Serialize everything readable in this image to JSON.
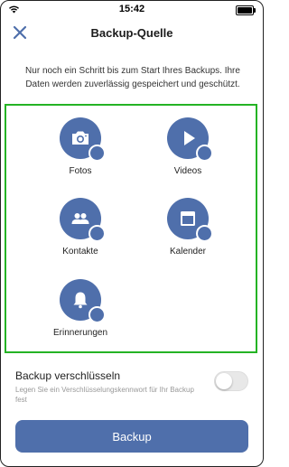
{
  "status": {
    "time": "15:42"
  },
  "header": {
    "title": "Backup-Quelle"
  },
  "description": "Nur noch ein Schritt bis zum Start Ihres Backups. Ihre Daten werden zuverlässig gespeichert und geschützt.",
  "sources": [
    {
      "label": "Fotos",
      "icon": "camera-icon",
      "selected": true
    },
    {
      "label": "Videos",
      "icon": "play-icon",
      "selected": true
    },
    {
      "label": "Kontakte",
      "icon": "contacts-icon",
      "selected": true
    },
    {
      "label": "Kalender",
      "icon": "calendar-icon",
      "selected": true
    },
    {
      "label": "Erinnerungen",
      "icon": "bell-icon",
      "selected": true
    }
  ],
  "encrypt": {
    "title": "Backup verschlüsseln",
    "hint": "Legen Sie ein Verschlüsselungskennwort für Ihr Backup fest",
    "enabled": false
  },
  "backup_button": {
    "label": "Backup"
  },
  "colors": {
    "accent": "#4f6fab",
    "panel_border": "#24b324"
  }
}
